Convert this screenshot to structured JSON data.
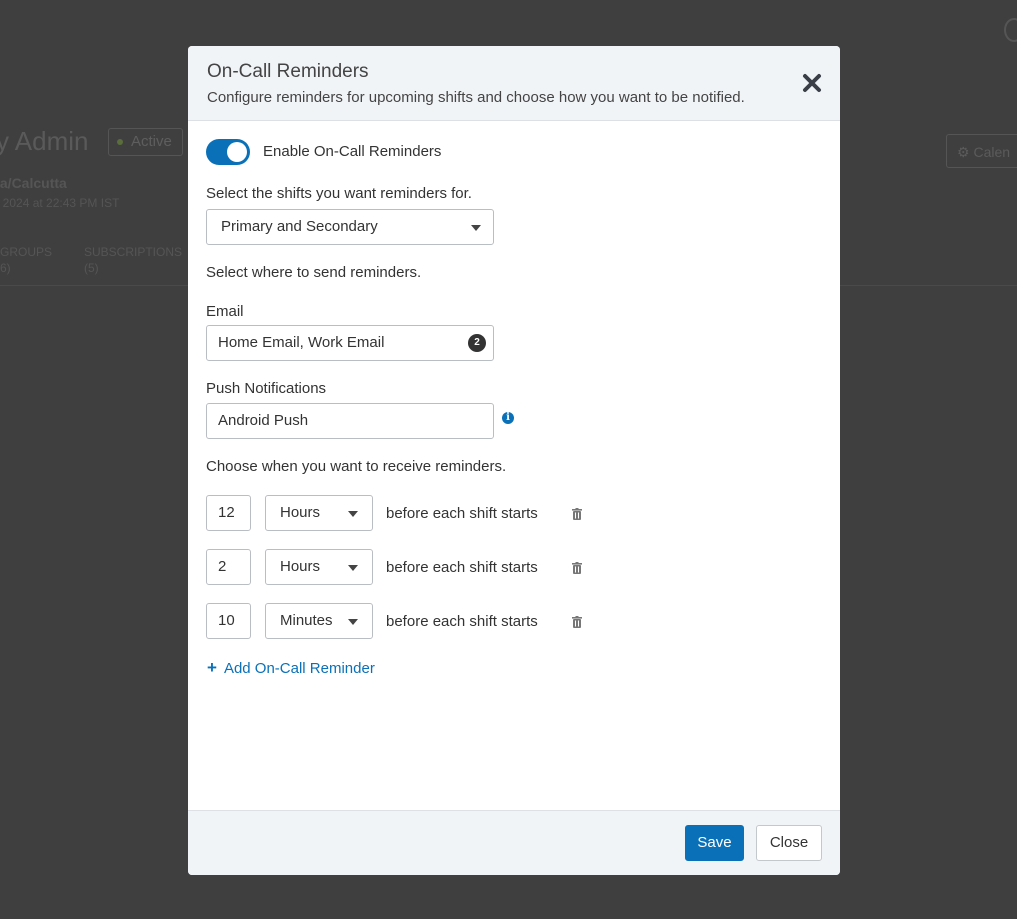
{
  "background": {
    "title_fragment": "y Admin",
    "status": "Active",
    "timezone": "ia/Calcutta",
    "date": ", 2024 at 22:43 PM IST",
    "tabs": [
      {
        "label": "GROUPS",
        "count": "6)"
      },
      {
        "label": "SUBSCRIPTIONS",
        "count": "(5)"
      }
    ],
    "calendar_button": "Calen"
  },
  "modal": {
    "title": "On-Call Reminders",
    "subtitle": "Configure reminders for upcoming shifts and choose how you want to be notified.",
    "toggle": {
      "label": "Enable On-Call Reminders",
      "enabled": true
    },
    "shifts": {
      "label": "Select the shifts you want reminders for.",
      "value": "Primary and Secondary"
    },
    "send_where_label": "Select where to send reminders.",
    "email": {
      "label": "Email",
      "value": "Home Email, Work Email",
      "count": "2"
    },
    "push": {
      "label": "Push Notifications",
      "value": "Android Push"
    },
    "when_label": "Choose when you want to receive reminders.",
    "reminders": [
      {
        "amount": "12",
        "unit": "Hours",
        "suffix": "before each shift starts"
      },
      {
        "amount": "2",
        "unit": "Hours",
        "suffix": "before each shift starts"
      },
      {
        "amount": "10",
        "unit": "Minutes",
        "suffix": "before each shift starts"
      }
    ],
    "add_label": "Add On-Call Reminder",
    "save_label": "Save",
    "close_label": "Close"
  },
  "colors": {
    "accent": "#0a71b9",
    "overlay": "#3d3d3d",
    "header_bg": "#f1f4f7"
  },
  "icons": [
    "close-icon",
    "chevron-down-icon",
    "info-icon",
    "trash-icon",
    "plus-icon",
    "gear-icon"
  ]
}
